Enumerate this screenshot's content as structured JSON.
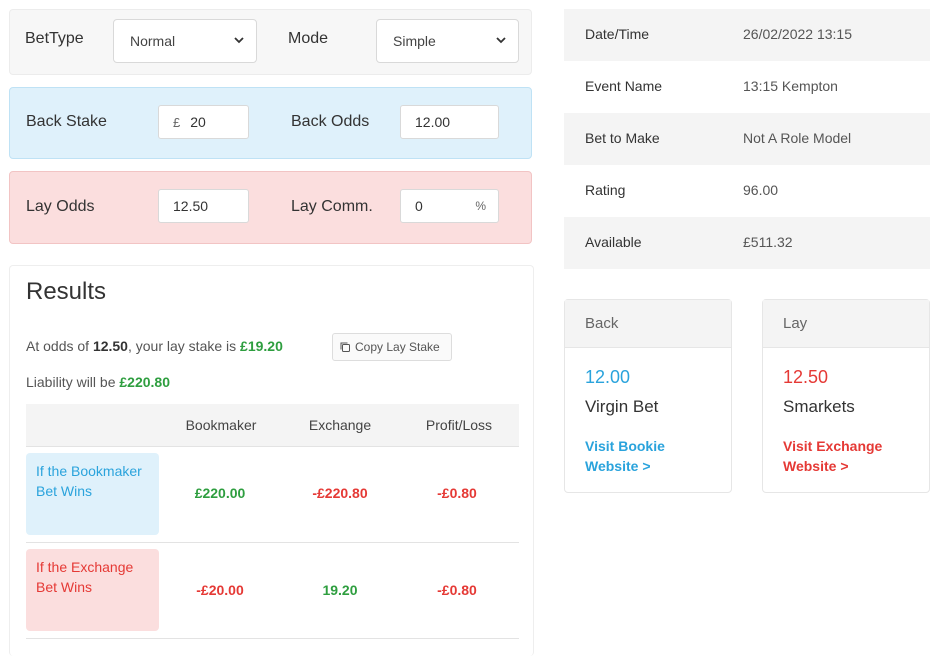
{
  "settings": {
    "bet_type_label": "BetType",
    "bet_type_value": "Normal",
    "mode_label": "Mode",
    "mode_value": "Simple"
  },
  "back": {
    "stake_label": "Back Stake",
    "currency": "£",
    "stake_value": "20",
    "odds_label": "Back Odds",
    "odds_value": "12.00"
  },
  "lay": {
    "odds_label": "Lay Odds",
    "odds_value": "12.50",
    "comm_label": "Lay Comm.",
    "comm_value": "0",
    "comm_unit": "%"
  },
  "results": {
    "title": "Results",
    "line1_prefix": "At odds of ",
    "line1_odds": "12.50",
    "line1_mid": ", your lay stake is ",
    "line1_stake": "£19.20",
    "copy_button": "Copy Lay Stake",
    "line2_prefix": "Liability will be ",
    "line2_value": "£220.80",
    "columns": [
      "Bookmaker",
      "Exchange",
      "Profit/Loss"
    ],
    "rows": [
      {
        "scenario": "If the Bookmaker Bet Wins",
        "bookmaker": "£220.00",
        "exchange": "-£220.80",
        "profit": "-£0.80"
      },
      {
        "scenario": "If the Exchange Bet Wins",
        "bookmaker": "-£20.00",
        "exchange": "19.20",
        "profit": "-£0.80"
      }
    ]
  },
  "info": {
    "rows": [
      {
        "key": "Date/Time",
        "value": "26/02/2022 13:15"
      },
      {
        "key": "Event Name",
        "value": "13:15 Kempton"
      },
      {
        "key": "Bet to Make",
        "value": "Not A Role Model"
      },
      {
        "key": "Rating",
        "value": "96.00"
      },
      {
        "key": "Available",
        "value": "£511.32"
      }
    ]
  },
  "back_card": {
    "header": "Back",
    "odds": "12.00",
    "name": "Virgin Bet",
    "link": "Visit Bookie Website >"
  },
  "lay_card": {
    "header": "Lay",
    "odds": "12.50",
    "name": "Smarkets",
    "link": "Visit Exchange Website >"
  },
  "colors": {
    "back_blue": "#2aa3dc",
    "lay_red": "#e53935",
    "positive_green": "#2e9e3f"
  }
}
